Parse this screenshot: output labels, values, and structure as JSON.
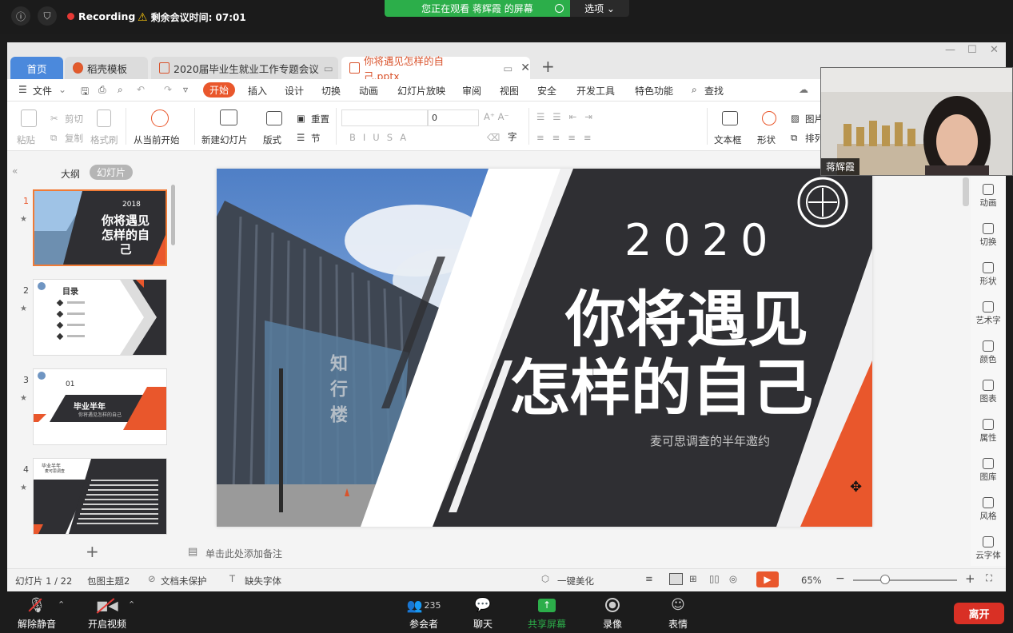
{
  "zoom_top": {
    "recording": "Recording",
    "time_left": "剩余会议时间: 07:01",
    "viewing": "您正在观看 蒋辉霞 的屏幕",
    "options": "选项 ⌄"
  },
  "tabs": [
    "首页",
    "稻壳模板",
    "2020届毕业生就业工作专题会议",
    "你将遇见怎样的自己.pptx"
  ],
  "menu": {
    "file": "文件",
    "items": [
      "开始",
      "插入",
      "设计",
      "切换",
      "动画",
      "幻灯片放映",
      "审阅",
      "视图",
      "安全",
      "开发工具",
      "特色功能"
    ],
    "search": "查找"
  },
  "ribbon": {
    "paste": "粘贴",
    "cut": "剪切",
    "copy": "复制",
    "format_painter": "格式刷",
    "from_current": "从当前开始",
    "new_slide": "新建幻灯片",
    "layout": "版式",
    "reset": "重置",
    "section": "节",
    "font_size": "0",
    "textbox": "文本框",
    "shape": "形状",
    "picture": "图片",
    "arrange": "排列"
  },
  "left_panel": {
    "outline": "大纲",
    "slides": "幻灯片",
    "thumbs": [
      {
        "n": "1",
        "year": "2018",
        "title": "你将遇见怎样的自己"
      },
      {
        "n": "2",
        "title": "目录"
      },
      {
        "n": "3",
        "num": "01",
        "title": "毕业半年",
        "sub": "你将遇见怎样的自己"
      },
      {
        "n": "4",
        "title": "毕业半年",
        "sub": "麦可思调查"
      }
    ]
  },
  "slide": {
    "year": "2020",
    "line1": "你将遇见",
    "line2": "怎样的自己",
    "subtitle": "麦可思调查的半年邀约",
    "building_sign": "知行楼"
  },
  "right_side": [
    "动画",
    "切换",
    "形状",
    "艺术字",
    "颜色",
    "图表",
    "属性",
    "图库",
    "风格",
    "云字体"
  ],
  "notes": "单击此处添加备注",
  "status": {
    "slide_count": "幻灯片 1 / 22",
    "theme": "包图主题2",
    "protect": "文档未保护",
    "missing_font": "缺失字体",
    "beautify": "一键美化",
    "zoom": "65%"
  },
  "webcam": {
    "name": "蒋辉霞"
  },
  "zoom_bottom": {
    "mute": "解除静音",
    "video": "开启视频",
    "participants": "参会者",
    "participants_count": "235",
    "chat": "聊天",
    "share": "共享屏幕",
    "record": "录像",
    "reactions": "表情",
    "leave": "离开"
  },
  "colors": {
    "accent": "#e9572c",
    "zoom_green": "#2cae4a",
    "leave_red": "#d93025",
    "slide_dark": "#2f2f33"
  }
}
